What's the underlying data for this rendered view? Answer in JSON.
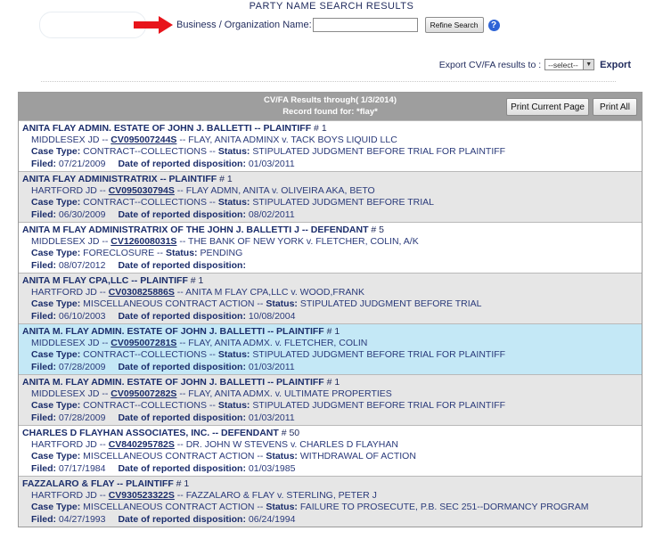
{
  "page_title": "PARTY NAME SEARCH RESULTS",
  "search": {
    "label": "Business / Organization Name:",
    "value": "",
    "refine_label": "Refine Search",
    "help_glyph": "?"
  },
  "export": {
    "label": "Export CV/FA results to :",
    "select_value": "--select--",
    "link_label": "Export"
  },
  "results": {
    "header_line1": "CV/FA Results through( 1/3/2014)",
    "header_line2": "Record found for:   *flay*",
    "print_current_label": "Print Current Page",
    "print_all_label": "Print All",
    "records": [
      {
        "party": "ANITA FLAY ADMIN. ESTATE OF JOHN J. BALLETTI -- PLAINTIFF",
        "party_num": " # 1",
        "court": "MIDDLESEX JD -- ",
        "docket": "CV095007244S",
        "caption": " -- FLAY, ANITA ADMINX v. TACK BOYS LIQUID LLC",
        "case_type_label": "Case Type:",
        "case_type": " CONTRACT--COLLECTIONS -- ",
        "status_label": "Status:",
        "status": " STIPULATED JUDGMENT BEFORE TRIAL FOR PLAINTIFF",
        "filed_label": "Filed:",
        "filed": " 07/21/2009",
        "disp_label": "Date of reported disposition:",
        "disp": " 01/03/2011"
      },
      {
        "party": "ANITA FLAY ADMINISTRATRIX -- PLAINTIFF",
        "party_num": " # 1",
        "court": "HARTFORD JD -- ",
        "docket": "CV095030794S",
        "caption": " -- FLAY ADMN, ANITA v. OLIVEIRA AKA, BETO",
        "case_type_label": "Case Type:",
        "case_type": " CONTRACT--COLLECTIONS -- ",
        "status_label": "Status:",
        "status": " STIPULATED JUDGMENT BEFORE TRIAL",
        "filed_label": "Filed:",
        "filed": " 06/30/2009",
        "disp_label": "Date of reported disposition:",
        "disp": " 08/02/2011"
      },
      {
        "party": "ANITA M FLAY ADMINISTRATRIX OF THE JOHN J. BALLETTI J -- DEFENDANT",
        "party_num": " # 5",
        "court": "MIDDLESEX JD -- ",
        "docket": "CV126008031S",
        "caption": " -- THE BANK OF NEW YORK v. FLETCHER, COLIN, A/K",
        "case_type_label": "Case Type:",
        "case_type": " FORECLOSURE -- ",
        "status_label": "Status:",
        "status": " PENDING",
        "filed_label": "Filed:",
        "filed": " 08/07/2012",
        "disp_label": "Date of reported disposition:",
        "disp": ""
      },
      {
        "party": "ANITA M FLAY CPA,LLC -- PLAINTIFF",
        "party_num": " # 1",
        "court": "HARTFORD JD -- ",
        "docket": "CV030825886S",
        "caption": " -- ANITA M FLAY CPA,LLC v. WOOD,FRANK",
        "case_type_label": "Case Type:",
        "case_type": " MISCELLANEOUS CONTRACT ACTION -- ",
        "status_label": "Status:",
        "status": " STIPULATED JUDGMENT BEFORE TRIAL",
        "filed_label": "Filed:",
        "filed": " 06/10/2003",
        "disp_label": "Date of reported disposition:",
        "disp": " 10/08/2004"
      },
      {
        "party": "ANITA M. FLAY ADMIN. ESTATE OF JOHN J. BALLETTI -- PLAINTIFF",
        "party_num": " # 1",
        "court": "MIDDLESEX JD -- ",
        "docket": "CV095007281S",
        "caption": " -- FLAY, ANITA ADMX. v. FLETCHER, COLIN",
        "case_type_label": "Case Type:",
        "case_type": " CONTRACT--COLLECTIONS -- ",
        "status_label": "Status:",
        "status": " STIPULATED JUDGMENT BEFORE TRIAL FOR PLAINTIFF",
        "filed_label": "Filed:",
        "filed": " 07/28/2009",
        "disp_label": "Date of reported disposition:",
        "disp": " 01/03/2011"
      },
      {
        "party": "ANITA M. FLAY ADMIN. ESTATE OF JOHN J. BALLETTI -- PLAINTIFF",
        "party_num": " # 1",
        "court": "MIDDLESEX JD -- ",
        "docket": "CV095007282S",
        "caption": " -- FLAY, ANITA ADMX. v. ULTIMATE PROPERTIES",
        "case_type_label": "Case Type:",
        "case_type": " CONTRACT--COLLECTIONS -- ",
        "status_label": "Status:",
        "status": " STIPULATED JUDGMENT BEFORE TRIAL FOR PLAINTIFF",
        "filed_label": "Filed:",
        "filed": " 07/28/2009",
        "disp_label": "Date of reported disposition:",
        "disp": " 01/03/2011"
      },
      {
        "party": "CHARLES D FLAYHAN ASSOCIATES, INC. -- DEFENDANT",
        "party_num": " # 50",
        "court": "HARTFORD JD -- ",
        "docket": "CV840295782S",
        "caption": " -- DR. JOHN W STEVENS v. CHARLES D FLAYHAN",
        "case_type_label": "Case Type:",
        "case_type": " MISCELLANEOUS CONTRACT ACTION -- ",
        "status_label": "Status:",
        "status": " WITHDRAWAL OF ACTION",
        "filed_label": "Filed:",
        "filed": " 07/17/1984",
        "disp_label": "Date of reported disposition:",
        "disp": " 01/03/1985"
      },
      {
        "party": "FAZZALARO & FLAY -- PLAINTIFF",
        "party_num": " # 1",
        "court": "HARTFORD JD -- ",
        "docket": "CV930523322S",
        "caption": " -- FAZZALARO & FLAY v. STERLING, PETER J",
        "case_type_label": "Case Type:",
        "case_type": " MISCELLANEOUS CONTRACT ACTION -- ",
        "status_label": "Status:",
        "status": " FAILURE TO PROSECUTE, P.B. SEC 251--DORMANCY PROGRAM",
        "filed_label": "Filed:",
        "filed": " 04/27/1993",
        "disp_label": "Date of reported disposition:",
        "disp": " 06/24/1994"
      }
    ]
  },
  "colors": {
    "header_bg": "#9e9e9e",
    "row_even_bg": "#e6e6e6",
    "row_highlight_bg": "#c4e8f6",
    "text": "#1f2a5c",
    "arrow": "#e8141b"
  },
  "icons": {
    "arrow": "red-arrow-icon",
    "help": "help-icon"
  }
}
